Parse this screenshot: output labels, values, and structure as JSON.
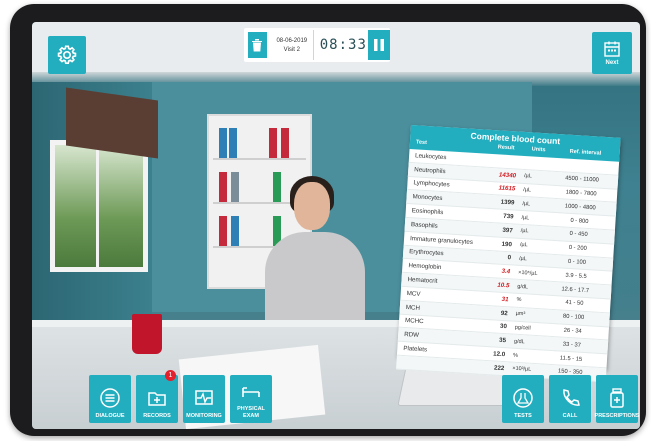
{
  "topbar": {
    "date": "08-06-2019",
    "visit": "Visit 2",
    "timer": "08:33"
  },
  "next_button": {
    "label": "Next"
  },
  "bottom_left": [
    {
      "id": "dialogue",
      "label": "DIALOGUE",
      "icon": "list-icon"
    },
    {
      "id": "records",
      "label": "RECORDS",
      "icon": "folder-plus-icon",
      "badge": "1"
    },
    {
      "id": "monitoring",
      "label": "MONITORING",
      "icon": "heart-monitor-icon"
    },
    {
      "id": "physical-exam",
      "label": "PHYSICAL EXAM",
      "icon": "exam-bed-icon"
    }
  ],
  "bottom_right": [
    {
      "id": "tests",
      "label": "TESTS",
      "icon": "flask-icon"
    },
    {
      "id": "call",
      "label": "CALL",
      "icon": "phone-icon"
    },
    {
      "id": "prescriptions",
      "label": "PRESCRIPTIONS",
      "icon": "pill-bottle-icon"
    }
  ],
  "cbc": {
    "title": "Complete blood count",
    "columns": {
      "test": "Test",
      "result": "Result",
      "units": "Units",
      "ref": "Ref. interval"
    },
    "rows": [
      {
        "test": "Leukocytes",
        "result": "",
        "unit": "",
        "ref": "",
        "high": false
      },
      {
        "test": "Neutrophils",
        "result": "14340",
        "unit": "/µL",
        "ref": "4500 - 11000",
        "high": true
      },
      {
        "test": "Lymphocytes",
        "result": "11615",
        "unit": "/µL",
        "ref": "1800 - 7800",
        "high": true
      },
      {
        "test": "Monocytes",
        "result": "1399",
        "unit": "/µL",
        "ref": "1000 - 4800",
        "high": false
      },
      {
        "test": "Eosinophils",
        "result": "739",
        "unit": "/µL",
        "ref": "0 - 800",
        "high": false
      },
      {
        "test": "Basophils",
        "result": "397",
        "unit": "/µL",
        "ref": "0 - 450",
        "high": false
      },
      {
        "test": "Immature granulocytes",
        "result": "190",
        "unit": "/µL",
        "ref": "0 - 200",
        "high": false
      },
      {
        "test": "Erythrocytes",
        "result": "0",
        "unit": "/µL",
        "ref": "0 - 100",
        "high": false
      },
      {
        "test": "Hemoglobin",
        "result": "3.4",
        "unit": "×10⁶/µL",
        "ref": "3.9 - 5.5",
        "high": true
      },
      {
        "test": "Hematocrit",
        "result": "10.5",
        "unit": "g/dL",
        "ref": "12.6 - 17.7",
        "high": true
      },
      {
        "test": "MCV",
        "result": "31",
        "unit": "%",
        "ref": "41 - 50",
        "high": true
      },
      {
        "test": "MCH",
        "result": "92",
        "unit": "µm³",
        "ref": "80 - 100",
        "high": false
      },
      {
        "test": "MCHC",
        "result": "30",
        "unit": "pg/cell",
        "ref": "26 - 34",
        "high": false
      },
      {
        "test": "RDW",
        "result": "35",
        "unit": "g/dL",
        "ref": "33 - 37",
        "high": false
      },
      {
        "test": "Platelets",
        "result": "12.0",
        "unit": "%",
        "ref": "11.5 - 15",
        "high": false
      },
      {
        "test": "",
        "result": "222",
        "unit": "×10³/µL",
        "ref": "150 - 350",
        "high": false
      }
    ]
  },
  "colors": {
    "accent": "#23aebf",
    "alert": "#d21a20",
    "badge": "#e3202b"
  }
}
